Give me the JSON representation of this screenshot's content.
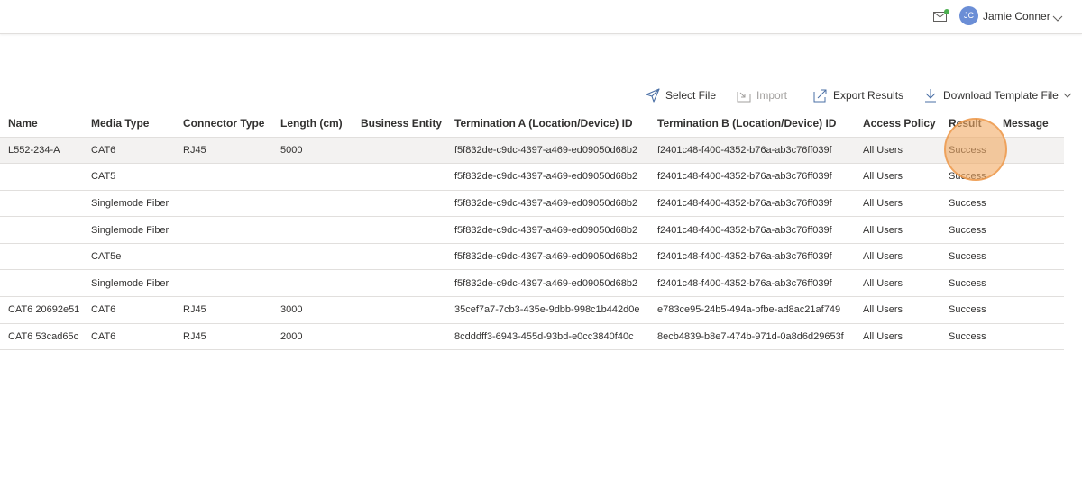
{
  "header": {
    "user_initials": "JC",
    "user_name": "Jamie Conner",
    "notification_color": "#4caf50"
  },
  "toolbar": {
    "select_file": "Select File",
    "import": "Import",
    "export_results": "Export Results",
    "download_template": "Download Template File"
  },
  "table": {
    "columns": [
      "Name",
      "Media Type",
      "Connector Type",
      "Length (cm)",
      "Business Entity",
      "Termination A (Location/Device) ID",
      "Termination B (Location/Device) ID",
      "Access Policy",
      "Result",
      "Message"
    ],
    "rows": [
      {
        "name": "L552-234-A",
        "media_type": "CAT6",
        "connector_type": "RJ45",
        "length": "5000",
        "business_entity": "",
        "termination_a": "f5f832de-c9dc-4397-a469-ed09050d68b2",
        "termination_b": "f2401c48-f400-4352-b76a-ab3c76ff039f",
        "access_policy": "All Users",
        "result": "Success",
        "message": ""
      },
      {
        "name": "",
        "media_type": "CAT5",
        "connector_type": "",
        "length": "",
        "business_entity": "",
        "termination_a": "f5f832de-c9dc-4397-a469-ed09050d68b2",
        "termination_b": "f2401c48-f400-4352-b76a-ab3c76ff039f",
        "access_policy": "All Users",
        "result": "Success",
        "message": ""
      },
      {
        "name": "",
        "media_type": "Singlemode Fiber",
        "connector_type": "",
        "length": "",
        "business_entity": "",
        "termination_a": "f5f832de-c9dc-4397-a469-ed09050d68b2",
        "termination_b": "f2401c48-f400-4352-b76a-ab3c76ff039f",
        "access_policy": "All Users",
        "result": "Success",
        "message": ""
      },
      {
        "name": "",
        "media_type": "Singlemode Fiber",
        "connector_type": "",
        "length": "",
        "business_entity": "",
        "termination_a": "f5f832de-c9dc-4397-a469-ed09050d68b2",
        "termination_b": "f2401c48-f400-4352-b76a-ab3c76ff039f",
        "access_policy": "All Users",
        "result": "Success",
        "message": ""
      },
      {
        "name": "",
        "media_type": "CAT5e",
        "connector_type": "",
        "length": "",
        "business_entity": "",
        "termination_a": "f5f832de-c9dc-4397-a469-ed09050d68b2",
        "termination_b": "f2401c48-f400-4352-b76a-ab3c76ff039f",
        "access_policy": "All Users",
        "result": "Success",
        "message": ""
      },
      {
        "name": "",
        "media_type": "Singlemode Fiber",
        "connector_type": "",
        "length": "",
        "business_entity": "",
        "termination_a": "f5f832de-c9dc-4397-a469-ed09050d68b2",
        "termination_b": "f2401c48-f400-4352-b76a-ab3c76ff039f",
        "access_policy": "All Users",
        "result": "Success",
        "message": ""
      },
      {
        "name": "CAT6 20692e51",
        "media_type": "CAT6",
        "connector_type": "RJ45",
        "length": "3000",
        "business_entity": "",
        "termination_a": "35cef7a7-7cb3-435e-9dbb-998c1b442d0e",
        "termination_b": "e783ce95-24b5-494a-bfbe-ad8ac21af749",
        "access_policy": "All Users",
        "result": "Success",
        "message": ""
      },
      {
        "name": "CAT6 53cad65c",
        "media_type": "CAT6",
        "connector_type": "RJ45",
        "length": "2000",
        "business_entity": "",
        "termination_a": "8cdddff3-6943-455d-93bd-e0cc3840f40c",
        "termination_b": "8ecb4839-b8e7-474b-971d-0a8d6d29653f",
        "access_policy": "All Users",
        "result": "Success",
        "message": ""
      }
    ]
  },
  "icons": {
    "mail": "mail-icon",
    "select_file": "send-icon",
    "import": "import-icon",
    "export": "export-icon",
    "download": "download-icon",
    "chevron": "chevron-down-icon"
  }
}
